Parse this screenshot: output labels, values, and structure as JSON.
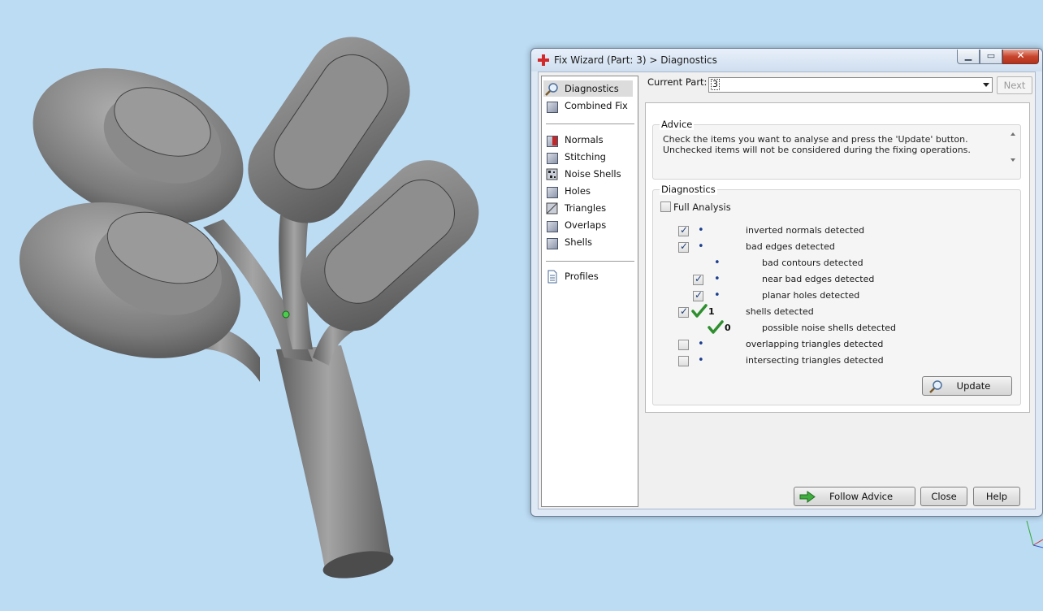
{
  "window": {
    "title": "Fix Wizard (Part: 3) > Diagnostics"
  },
  "nav": {
    "top": [
      {
        "label": "Diagnostics",
        "icon": "magnifier-icon",
        "selected": true
      },
      {
        "label": "Combined Fix",
        "icon": "cube-icon"
      }
    ],
    "fixes": [
      {
        "label": "Normals",
        "icon": "normals-cube-icon"
      },
      {
        "label": "Stitching",
        "icon": "cube-icon"
      },
      {
        "label": "Noise Shells",
        "icon": "noise-shells-icon"
      },
      {
        "label": "Holes",
        "icon": "cube-icon"
      },
      {
        "label": "Triangles",
        "icon": "triangles-cube-icon"
      },
      {
        "label": "Overlaps",
        "icon": "cube-icon"
      },
      {
        "label": "Shells",
        "icon": "cube-icon"
      }
    ],
    "bottom": [
      {
        "label": "Profiles",
        "icon": "document-icon"
      }
    ]
  },
  "current_part": {
    "label": "Current Part:",
    "value": "3"
  },
  "next_label": "Next",
  "advice": {
    "title": "Advice",
    "text": "Check the items you want to analyse and press the 'Update' button. Unchecked items will not be considered during the fixing operations."
  },
  "diagnostics": {
    "title": "Diagnostics",
    "full_analysis": {
      "label": "Full Analysis",
      "checked": false
    },
    "rows": [
      {
        "label": "inverted normals detected",
        "checked": true,
        "status": "•"
      },
      {
        "label": "bad edges detected",
        "checked": true,
        "status": "•"
      },
      {
        "label": "bad contours detected",
        "status": "•"
      },
      {
        "label": "near bad edges detected",
        "checked": true,
        "status": "•"
      },
      {
        "label": "planar holes detected",
        "checked": true,
        "status": "•"
      },
      {
        "label": "shells detected",
        "checked": true,
        "count": "1"
      },
      {
        "label": "possible noise shells detected",
        "count": "0"
      },
      {
        "label": "overlapping triangles detected",
        "checked": false,
        "status": "•"
      },
      {
        "label": "intersecting triangles detected",
        "checked": false,
        "status": "•"
      }
    ],
    "update_label": "Update"
  },
  "footer": {
    "follow_advice": "Follow Advice",
    "close": "Close",
    "help": "Help"
  },
  "colors": {
    "background": "#bcdcf4",
    "model_gray": "#8c8c8c",
    "status_green": "#2f8f2f",
    "dot_blue": "#1c3f8f"
  }
}
